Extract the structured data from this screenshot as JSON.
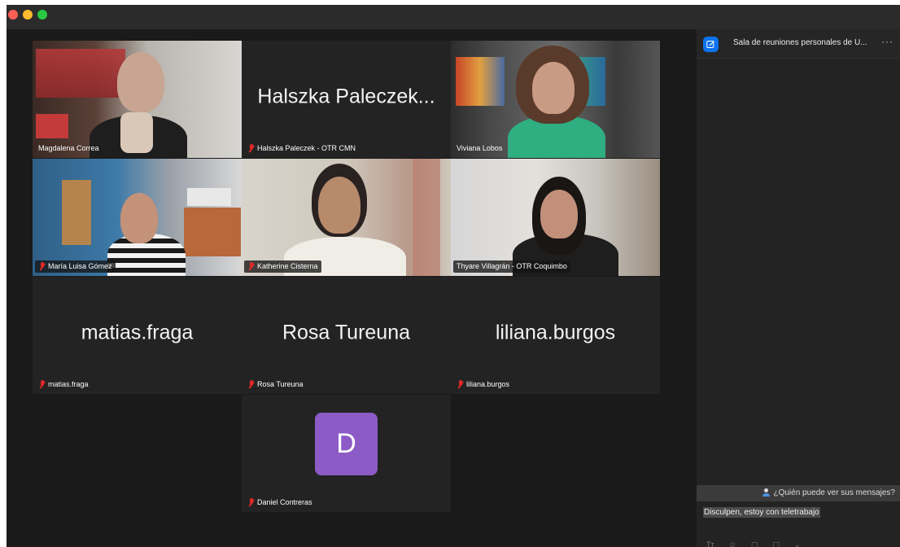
{
  "window": {
    "traffic_lights": {
      "close": "#fe5f57",
      "minimize": "#febc2e",
      "zoom": "#28c840"
    }
  },
  "tiles": [
    {
      "name": "Magdalena Correa",
      "type": "video",
      "muted": false
    },
    {
      "name": "Halszka Paleczek - OTR CMN",
      "display_name": "Halszka Paleczek...",
      "type": "name",
      "muted": true
    },
    {
      "name": "Viviana Lobos",
      "type": "video",
      "muted": false,
      "active": true
    },
    {
      "name": "María Luisa Gómez",
      "type": "video",
      "muted": true
    },
    {
      "name": "Katherine Cisterna",
      "type": "video",
      "muted": true
    },
    {
      "name": "Thyare Villagrán - OTR Coquimbo",
      "type": "video",
      "muted": false
    },
    {
      "name": "matias.fraga",
      "display_name": "matias.fraga",
      "type": "name",
      "muted": true
    },
    {
      "name": "Rosa Tureuna",
      "display_name": "Rosa Tureuna",
      "type": "name",
      "muted": true
    },
    {
      "name": "liliana.burgos",
      "display_name": "liliana.burgos",
      "type": "name",
      "muted": true
    },
    {
      "name": "Daniel Contreras",
      "avatar_letter": "D",
      "type": "avatar",
      "muted": true
    }
  ],
  "chat": {
    "title": "Sala de reuniones personales de U...",
    "more": "···",
    "who_can_see": "¿Quién puede ver sus mensajes?",
    "draft_message": "Disculpen, estoy con teletrabajo",
    "toolbar": [
      "Tт",
      "☺",
      "▢",
      "▢",
      "⌄"
    ]
  },
  "colors": {
    "active_speaker": "#23d959",
    "muted_mic": "#e02828",
    "avatar_bg": "#8c5bc6",
    "chat_icon": "#0e72ed"
  }
}
